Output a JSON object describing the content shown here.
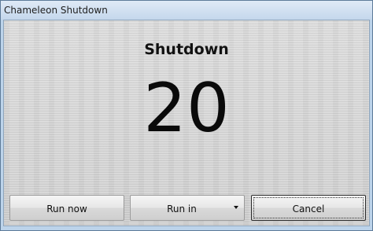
{
  "window": {
    "title": "Chameleon Shutdown"
  },
  "main": {
    "heading": "Shutdown",
    "countdown": "20"
  },
  "buttons": {
    "run_now": "Run now",
    "run_in": "Run in",
    "cancel": "Cancel"
  },
  "icons": {
    "run_in_dropdown": "caret-down-icon"
  }
}
